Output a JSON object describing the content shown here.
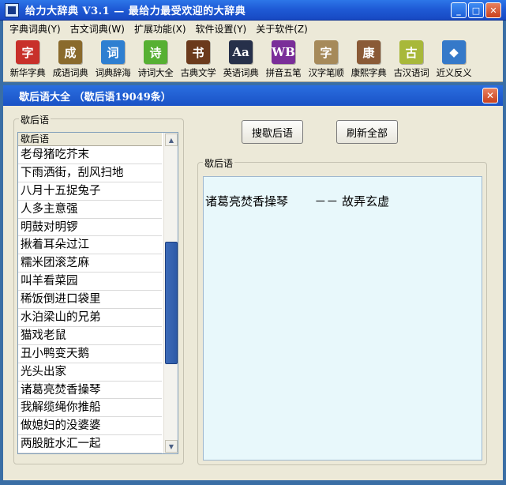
{
  "window": {
    "title": "给力大辞典 V3.1 — 最给力最受欢迎的大辞典"
  },
  "title_buttons": {
    "minimize": "_",
    "maximize": "□",
    "close": "✕"
  },
  "menu": [
    "字典词典(Y)",
    "古文词典(W)",
    "扩展功能(X)",
    "软件设置(Y)",
    "关于软件(Z)"
  ],
  "toolbar": [
    {
      "label": "新华字典",
      "glyph": "字",
      "color": "#c8302a",
      "icon": "xinhua-dict-icon"
    },
    {
      "label": "成语词典",
      "glyph": "成",
      "color": "#8a6a2c",
      "icon": "idiom-dict-icon"
    },
    {
      "label": "词典辞海",
      "glyph": "词",
      "color": "#2e7fd1",
      "icon": "cihai-icon"
    },
    {
      "label": "诗词大全",
      "glyph": "诗",
      "color": "#57b033",
      "icon": "poetry-icon"
    },
    {
      "label": "古典文学",
      "glyph": "书",
      "color": "#6b3a1c",
      "icon": "classic-lit-icon"
    },
    {
      "label": "英语词典",
      "glyph": "Aa",
      "color": "#26304a",
      "icon": "english-dict-icon"
    },
    {
      "label": "拼音五笔",
      "glyph": "WB",
      "color": "#7a2e99",
      "icon": "pinyin-wubi-icon"
    },
    {
      "label": "汉字笔顺",
      "glyph": "字",
      "color": "#a68a5a",
      "icon": "stroke-order-icon"
    },
    {
      "label": "康熙字典",
      "glyph": "康",
      "color": "#8a5a36",
      "icon": "kangxi-icon"
    },
    {
      "label": "古汉语词",
      "glyph": "古",
      "color": "#a8b83a",
      "icon": "ancient-chinese-icon"
    },
    {
      "label": "近义反义",
      "glyph": "◆",
      "color": "#3579c9",
      "icon": "synonym-icon"
    }
  ],
  "panel": {
    "title": "歇后语大全  （歇后语19049条）",
    "close": "✕"
  },
  "list_group": {
    "legend": "歇后语",
    "header": "歇后语"
  },
  "list_items": [
    "老母猪吃芥末",
    "下雨洒街，刮风扫地",
    "八月十五捉兔子",
    "人多主意强",
    "明鼓对明锣",
    "揪着耳朵过江",
    "糯米团滚芝麻",
    "叫羊看菜园",
    "稀饭倒进口袋里",
    "水泊梁山的兄弟",
    "猫戏老鼠",
    "丑小鸭变天鹅",
    "光头出家",
    "诸葛亮焚香操琴",
    "我解缆绳你推船",
    "做媳妇的没婆婆",
    "两股脏水汇一起"
  ],
  "buttons": {
    "search": "搜歇后语",
    "refresh": "刷新全部"
  },
  "result_group": {
    "legend": "歇后语"
  },
  "result": {
    "text": "诸葛亮焚香操琴       －－ 故弄玄虚"
  },
  "scroll": {
    "up": "▲",
    "down": "▼"
  }
}
